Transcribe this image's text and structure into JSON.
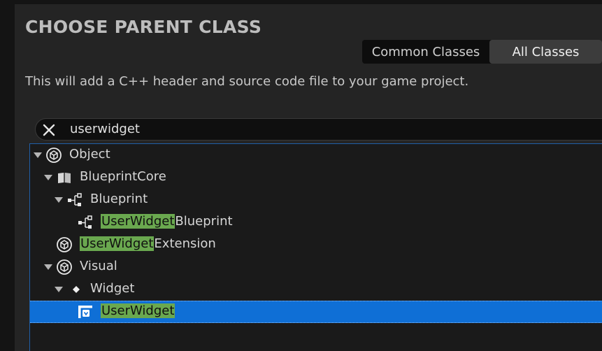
{
  "dialog": {
    "title": "CHOOSE PARENT CLASS",
    "description": "This will add a C++ header and source code file to your game project."
  },
  "tabs": {
    "common": "Common Classes",
    "all": "All Classes",
    "selected": "All Classes"
  },
  "search": {
    "value": "userwidget"
  },
  "tree": {
    "rows": [
      {
        "name": "Object",
        "match": "",
        "rest": "Object",
        "depth": 0,
        "expanded": true,
        "icon": "class-cube-icon"
      },
      {
        "name": "BlueprintCore",
        "match": "",
        "rest": "BlueprintCore",
        "depth": 1,
        "expanded": true,
        "icon": "book-icon"
      },
      {
        "name": "Blueprint",
        "match": "",
        "rest": "Blueprint",
        "depth": 2,
        "expanded": true,
        "icon": "graph-node-icon"
      },
      {
        "name": "UserWidgetBlueprint",
        "match": "UserWidget",
        "rest": "Blueprint",
        "depth": 3,
        "expanded": false,
        "icon": "graph-node-icon"
      },
      {
        "name": "UserWidgetExtension",
        "match": "UserWidget",
        "rest": "Extension",
        "depth": 1,
        "expanded": false,
        "icon": "class-cube-icon"
      },
      {
        "name": "Visual",
        "match": "",
        "rest": "Visual",
        "depth": 1,
        "expanded": true,
        "icon": "class-cube-icon"
      },
      {
        "name": "Widget",
        "match": "",
        "rest": "Widget",
        "depth": 2,
        "expanded": true,
        "icon": "diamond-icon"
      },
      {
        "name": "UserWidget",
        "match": "UserWidget",
        "rest": "",
        "depth": 3,
        "expanded": false,
        "icon": "user-widget-icon",
        "selected": true
      }
    ]
  },
  "colors": {
    "highlight": "#6aa84f",
    "selection": "#0f6fd6",
    "border_focus": "#1f5fa8"
  }
}
